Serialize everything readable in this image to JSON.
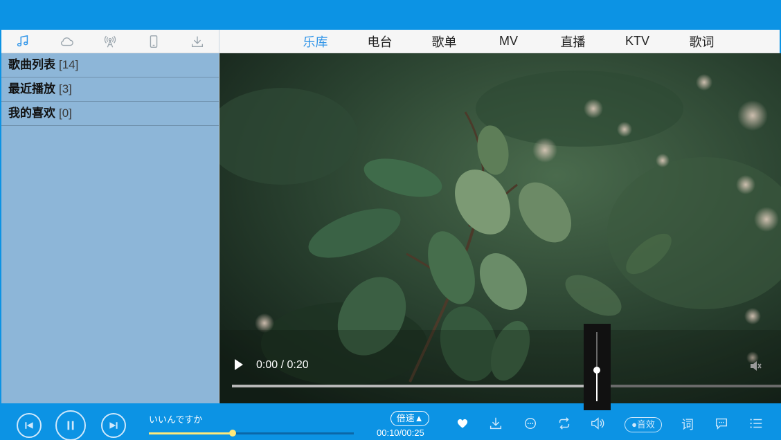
{
  "sidebar": {
    "tabs": [
      {
        "icon": "music-note-icon",
        "active": true
      },
      {
        "icon": "cloud-icon",
        "active": false
      },
      {
        "icon": "radio-antenna-icon",
        "active": false
      },
      {
        "icon": "mobile-phone-icon",
        "active": false
      },
      {
        "icon": "download-icon",
        "active": false
      }
    ],
    "playlists": [
      {
        "name": "歌曲列表",
        "count": "[14]"
      },
      {
        "name": "最近播放",
        "count": "[3]"
      },
      {
        "name": "我的喜欢",
        "count": "[0]"
      }
    ]
  },
  "nav": {
    "items": [
      "乐库",
      "电台",
      "歌单",
      "MV",
      "直播",
      "KTV",
      "歌词"
    ],
    "active_index": 0
  },
  "video": {
    "time": "0:00 / 0:20",
    "progress_fraction": 0.64
  },
  "volume_popup": {
    "level_fraction": 0.45
  },
  "player": {
    "song_title": "いいんですか",
    "progress_fraction": 0.41,
    "speed_label": "倍速▲",
    "time": "00:10/00:25",
    "effect_label": "●音效",
    "lyric_label": "词"
  },
  "colors": {
    "brand_blue": "#0c93e4",
    "sidebar_bg": "#8db6d8",
    "nav_active": "#2c93e8",
    "progress_yellow": "#ffe97a"
  }
}
